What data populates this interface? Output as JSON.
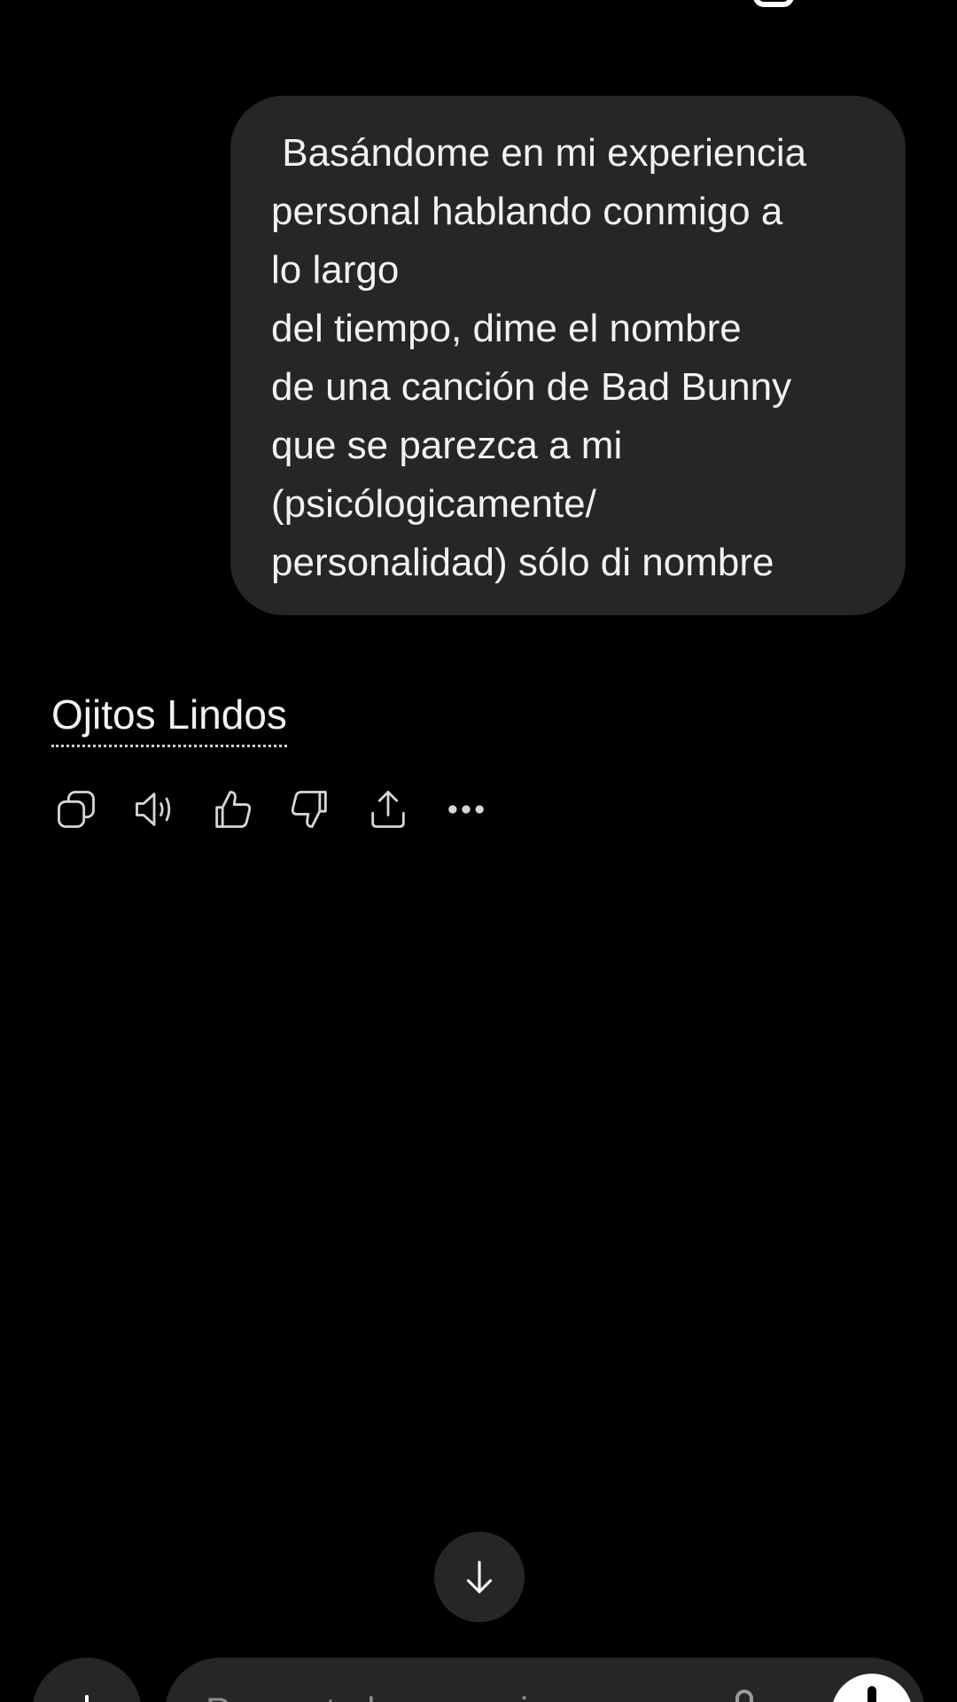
{
  "conversation": {
    "user_message_lines": [
      " Basándome en mi experiencia",
      "personal hablando conmigo a",
      "lo largo",
      "del tiempo, dime el nombre",
      "de una canción de Bad Bunny",
      "que se parezca a mi",
      "(psicólogicamente/",
      "personalidad) sólo di nombre"
    ],
    "assistant_reply": "Ojitos Lindos"
  },
  "actions": [
    {
      "name": "copy-icon"
    },
    {
      "name": "read-aloud-icon"
    },
    {
      "name": "thumbs-up-icon"
    },
    {
      "name": "thumbs-down-icon"
    },
    {
      "name": "share-icon"
    },
    {
      "name": "more-icon"
    }
  ],
  "scroll": {
    "icon": "arrow-down-icon"
  },
  "composer": {
    "placeholder": "Pregunta lo que quieras",
    "plus_icon": "plus-icon",
    "mic_icon": "mic-icon",
    "voice_icon": "voice-mode-icon"
  }
}
